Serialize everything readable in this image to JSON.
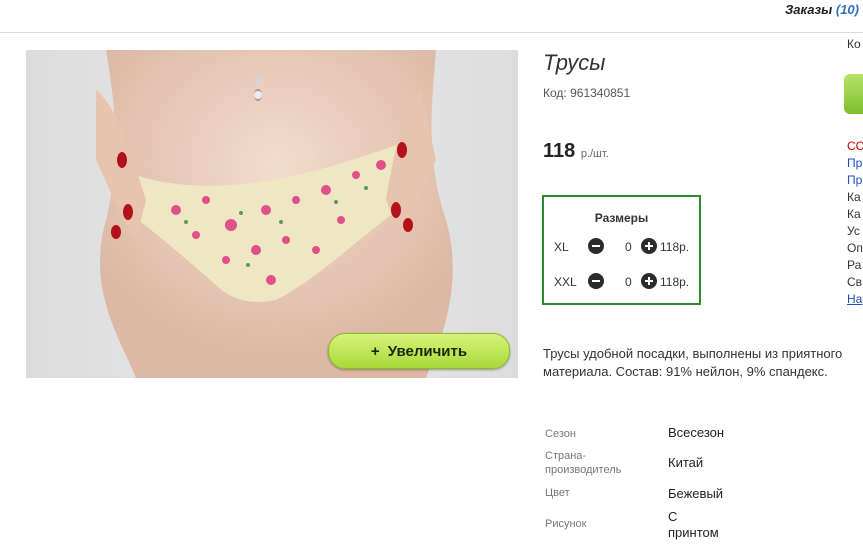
{
  "header": {
    "orders_label": "Заказы",
    "orders_count": "(10)"
  },
  "product": {
    "title": "Трусы",
    "code_label": "Код:",
    "code_value": "961340851",
    "price_value": "118",
    "price_unit": "р./шт.",
    "zoom_button_icon": "plus-icon",
    "zoom_button_label": "Увеличить",
    "description": "Трусы удобной посадки, выполнены из приятного материала. Состав: 91% нейлон, 9% спандекс."
  },
  "sizes": {
    "title": "Размеры",
    "rows": [
      {
        "name": "XL",
        "qty": "0",
        "price": "118р."
      },
      {
        "name": "XXL",
        "qty": "0",
        "price": "118р."
      }
    ]
  },
  "properties": [
    {
      "label": "Сезон",
      "value": "Всесезон"
    },
    {
      "label": "Страна-производитель",
      "value": "Китай"
    },
    {
      "label": "Цвет",
      "value": "Бежевый"
    },
    {
      "label": "Рисунок",
      "value": "С принтом"
    }
  ],
  "side_panel": {
    "lines": [
      "Ко",
      "",
      "",
      "",
      "",
      "СС",
      "Пр",
      "Пр",
      "Ка",
      "Ка",
      "Ус",
      "Оп",
      "Ра",
      "Св",
      "На"
    ]
  },
  "colors": {
    "accent_green": "#2e8b2e",
    "zoom_button": "#b7e04f",
    "link_blue": "#2f6fbf"
  }
}
